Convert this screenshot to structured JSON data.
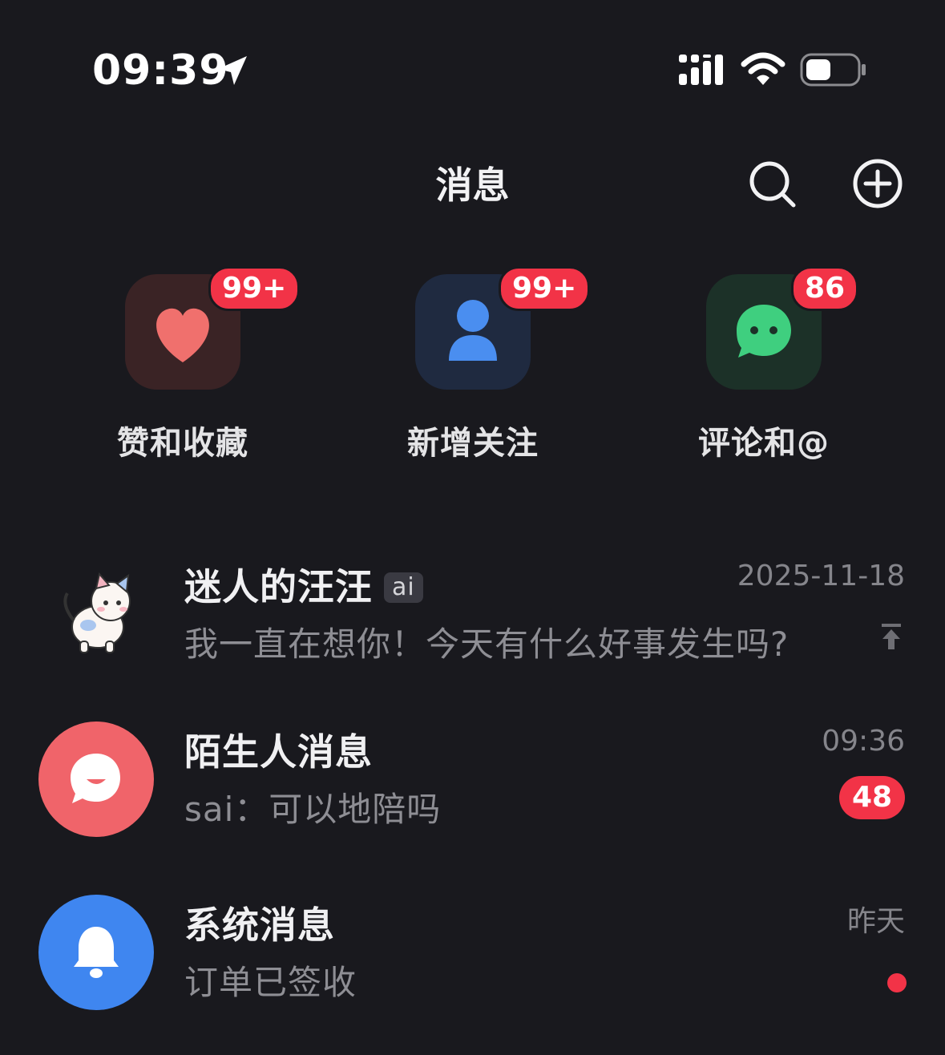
{
  "status_bar": {
    "time": "09:39"
  },
  "nav": {
    "title": "消息",
    "search_icon": "search-icon",
    "add_icon": "plus-circle-icon"
  },
  "quick_entries": [
    {
      "label": "赞和收藏",
      "badge": "99+",
      "icon": "heart-icon",
      "color": "#f0706d"
    },
    {
      "label": "新增关注",
      "badge": "99+",
      "icon": "person-icon",
      "color": "#4a8ef0"
    },
    {
      "label": "评论和@",
      "badge": "86",
      "icon": "chat-bubble-icon",
      "color": "#3fcf7f"
    }
  ],
  "messages": [
    {
      "name": "迷人的汪汪",
      "tag": "ai",
      "time": "2025-11-18",
      "preview": "我一直在想你！今天有什么好事发生吗?",
      "pinned": true
    },
    {
      "name": "陌生人消息",
      "time": "09:36",
      "preview": "sai：可以地陪吗",
      "unread": "48",
      "avatar_color": "#f0646a"
    },
    {
      "name": "系统消息",
      "time": "昨天",
      "preview": "订单已签收",
      "dot": true,
      "avatar_color": "#3f86f0"
    }
  ]
}
